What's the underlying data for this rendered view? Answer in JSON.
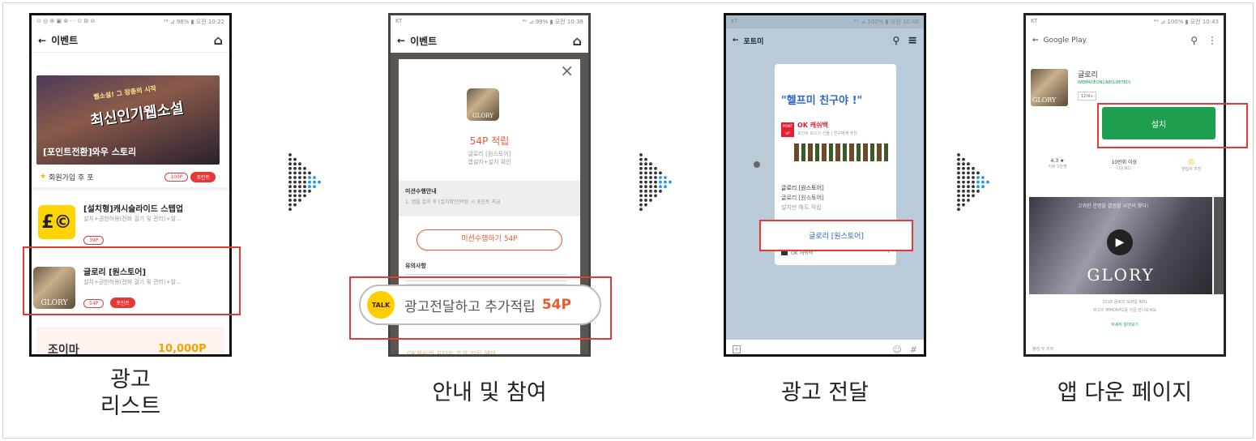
{
  "steps": [
    {
      "caption_line1": "광고",
      "caption_line2": "리스트"
    },
    {
      "caption": "안내 및 참여"
    },
    {
      "caption": "광고 전달"
    },
    {
      "caption": "앱 다운 페이지"
    }
  ],
  "phone1": {
    "status_left": "⊙ ◎ ⊕ ▣ ⊗ ··· ⊙ ⊞ ⊘",
    "status_right": "⁹⁸ ⊿ 98% ▮ 오전 10:22",
    "header_title": "이벤트",
    "banner_line1": "웹소설! 그 장충의 시작",
    "banner_line2": "최신인기웹소설",
    "banner_caption": "[포인트전환]와우 스토리",
    "banner_star_text": "회원가입 후 포",
    "banner_pill1": "100P",
    "banner_pill2": "포인트",
    "ad1_title": "[설치형]캐시슬라이드 스텝업",
    "ad1_desc": "설치+권한허용(전화 걸기 및 관리)+알...",
    "ad1_pill": "39P",
    "ad2_title": "글로리 [원스토어]",
    "ad2_desc": "설치+권한허용(전화 걸기 및 관리)+알...",
    "ad2_pill1": "54P",
    "ad2_pill2": "포인트",
    "ad2_icon_text": "GLORY",
    "bottom_promo": "10,000P",
    "bottom_left_text": "조이마"
  },
  "phone2": {
    "status_left": "KT",
    "status_right": "⁴ᴳ ⊿ 99% ▮ 오전 10:38",
    "header_title": "이벤트",
    "icon_text": "GLORY",
    "points": "54P 적립",
    "desc1": "글로리 [원스토어]",
    "desc2": "앱설치+설치 확인",
    "mission_title": "미션수행안내",
    "mission_text": "1. 앱을 설치 후 [설치확인]버튼 시 포인트 지급",
    "mission_button": "미션수행하기 54P",
    "caution_title": "유의사항",
    "talk_badge": "TALK",
    "talk_text": "광고전달하고 추가적립",
    "talk_points": "54P",
    "bottom_text": "OK캐쉬백 포인트 추가 적립 혜택"
  },
  "phone3": {
    "status_left": "KT",
    "status_right": "⁴ᴳ ⊿ 100% ▮ 오전 10:40",
    "header_title": "포트미",
    "msg_title": "\"헬프미 친구야 !\"",
    "brand_badge": "POINT UP",
    "brand_name": "OK 캐쉬백",
    "brand_desc": "포인트 모으기 선물 | 친구에게 추천",
    "chat_line1": "글로리 [원스토어]",
    "chat_line2": "글로리 [원스토어]",
    "chat_line3": "설치만 해도 적립",
    "link_button": "글로리 [원스토어]",
    "footer_text": "OK 캐쉬백",
    "input_hash": "#"
  },
  "phone4": {
    "status_left": "KT",
    "status_right": "⁴ᴳ ⊿ 100% ▮ 오전 10:43",
    "header_title": "Google Play",
    "app_name": "글로리",
    "app_dev": "WEMADEONLINE(LIMITED)",
    "app_rating_badge": "12세+",
    "install_button": "설치",
    "stat1_value": "4.3 ★",
    "stat1_label": "리뷰 1만명",
    "stat2_value": "10만회 이상",
    "stat2_label": "다운로드",
    "stat3_label": "편집자 추천",
    "video_title": "GLORY",
    "video_top_text": "고귀한 운명을 결정할 시간이 왔다!",
    "desc_line1": "2018 글로리 모바일 RPG",
    "desc_line2": "최고의 MMORPG를 지금 만나보세요",
    "more_link": "자세히 알아보기",
    "bottom_text": "평점 및 리뷰"
  },
  "colors": {
    "highlight": "#e53935",
    "play_green": "#1e9e4f",
    "arrow_blue": "#2196f3"
  }
}
